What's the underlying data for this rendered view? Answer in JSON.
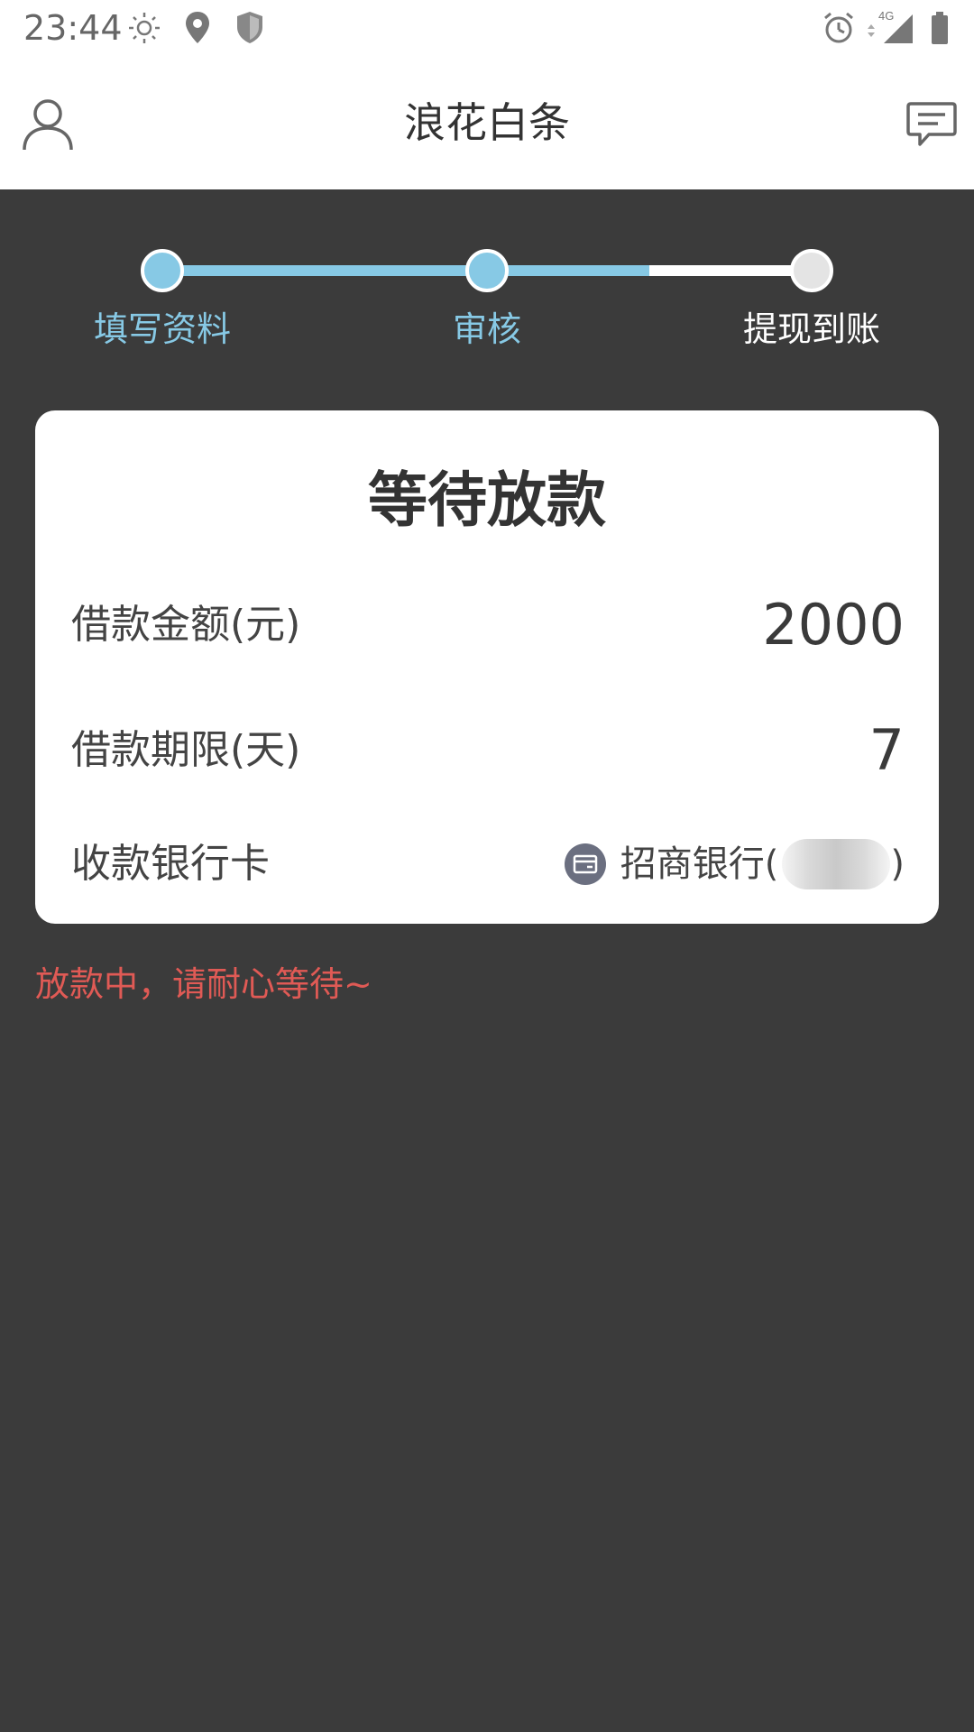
{
  "status_bar": {
    "time": "23:44",
    "network": "4G",
    "icons": [
      "brightness-icon",
      "location-icon",
      "shield-icon",
      "alarm-icon",
      "signal-icon",
      "battery-icon"
    ]
  },
  "app_bar": {
    "title": "浪花白条",
    "left_icon": "user-icon",
    "right_icon": "message-icon"
  },
  "stepper": {
    "steps": [
      {
        "label": "填写资料",
        "state": "done"
      },
      {
        "label": "审核",
        "state": "done"
      },
      {
        "label": "提现到账",
        "state": "pending"
      }
    ],
    "colors": {
      "active": "#87c9e5",
      "inactive": "#ffffff",
      "pending_dot": "#e4e4e4"
    }
  },
  "card": {
    "title": "等待放款",
    "rows": [
      {
        "label": "借款金额(元)",
        "value": "2000"
      },
      {
        "label": "借款期限(天)",
        "value": "7"
      }
    ],
    "bank_row": {
      "label": "收款银行卡",
      "bank_name": "招商银行(",
      "close_paren": ")",
      "icon": "bank-card-icon"
    }
  },
  "notice": "放款中，请耐心等待~",
  "colors": {
    "background": "#3b3b3b",
    "accent": "#87c9e5",
    "warning_text": "#e05a55"
  }
}
